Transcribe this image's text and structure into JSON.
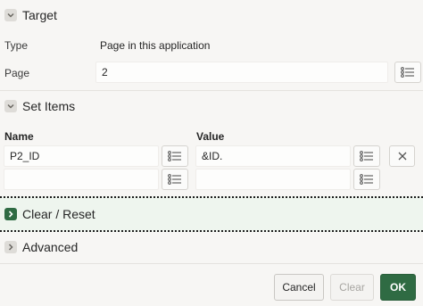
{
  "target": {
    "title": "Target",
    "type_label": "Type",
    "type_value": "Page in this application",
    "page_label": "Page",
    "page_value": "2",
    "page_icon": "list-icon"
  },
  "set_items": {
    "title": "Set Items",
    "name_header": "Name",
    "value_header": "Value",
    "rows": [
      {
        "name": "P2_ID",
        "value": "&ID."
      },
      {
        "name": "",
        "value": ""
      }
    ]
  },
  "clear_reset": {
    "title": "Clear / Reset",
    "expanded": false
  },
  "advanced": {
    "title": "Advanced",
    "expanded": false
  },
  "footer": {
    "cancel_label": "Cancel",
    "clear_label": "Clear",
    "ok_label": "OK"
  },
  "colors": {
    "accent": "#2f6b43",
    "clear_reset_bg": "#eef5ee",
    "panel_bg": "#f7f6f4"
  }
}
